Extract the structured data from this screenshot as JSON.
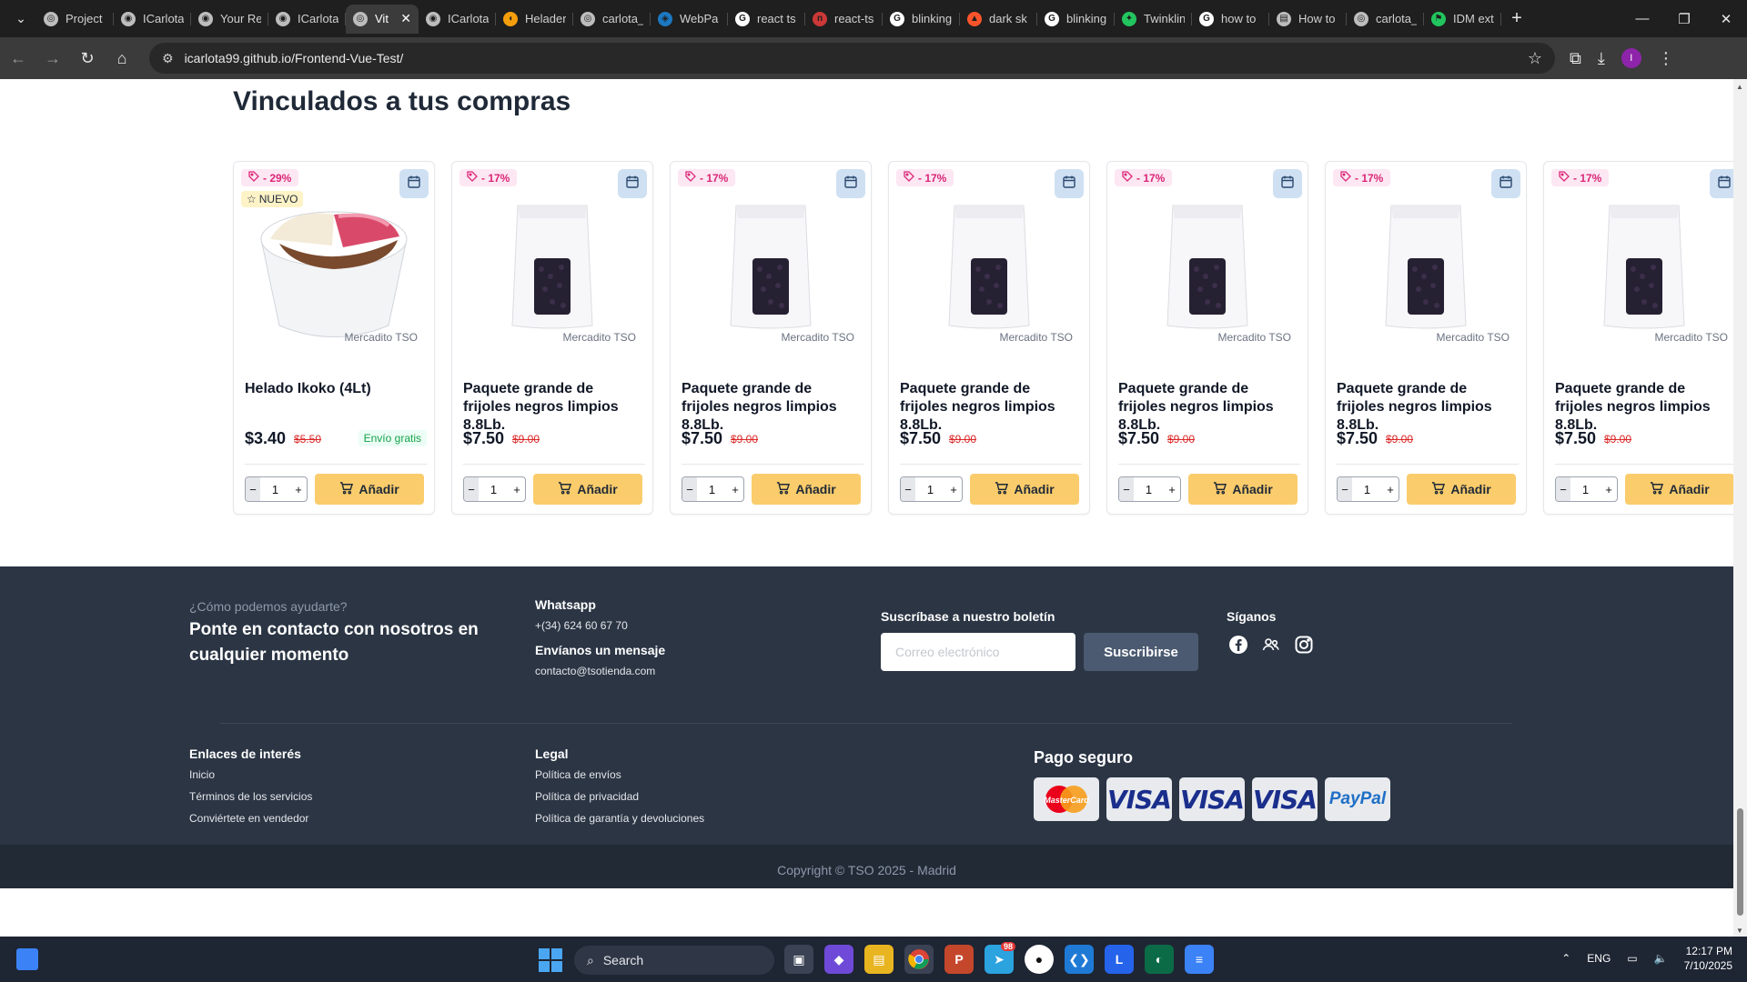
{
  "browser": {
    "tabs": [
      {
        "title": "Project",
        "icon": "globe-icon",
        "active": false
      },
      {
        "title": "ICarlota",
        "icon": "github-icon",
        "active": false
      },
      {
        "title": "Your Re",
        "icon": "github-icon",
        "active": false
      },
      {
        "title": "ICarlota",
        "icon": "github-icon",
        "active": false
      },
      {
        "title": "Vit",
        "icon": "globe-icon",
        "active": true
      },
      {
        "title": "ICarlota",
        "icon": "github-icon",
        "active": false
      },
      {
        "title": "Helader",
        "icon": "cone-icon",
        "active": false
      },
      {
        "title": "carlota_",
        "icon": "globe-icon",
        "active": false
      },
      {
        "title": "WebPa",
        "icon": "webpack-icon",
        "active": false
      },
      {
        "title": "react ts",
        "icon": "google-icon",
        "active": false
      },
      {
        "title": "react-ts",
        "icon": "npm-icon",
        "active": false
      },
      {
        "title": "blinking",
        "icon": "google-icon",
        "active": false
      },
      {
        "title": "dark sk",
        "icon": "brave-icon",
        "active": false
      },
      {
        "title": "blinking",
        "icon": "google-icon",
        "active": false
      },
      {
        "title": "Twinklin",
        "icon": "twinkle-icon",
        "active": false
      },
      {
        "title": "how to",
        "icon": "google-icon",
        "active": false
      },
      {
        "title": "How to",
        "icon": "doc-icon",
        "active": false
      },
      {
        "title": "carlota_",
        "icon": "globe-icon",
        "active": false
      },
      {
        "title": "IDM ext",
        "icon": "flag-icon",
        "active": false
      }
    ],
    "url": "icarlota99.github.io/Frontend-Vue-Test/",
    "profile_initial": "I"
  },
  "section": {
    "title": "Vinculados a tus compras"
  },
  "products": [
    {
      "discount": "- 29%",
      "is_new": true,
      "new_label": "NUEVO",
      "image": "ice-cream-tub",
      "seller": "Mercadito TSO",
      "name": "Helado Ikoko (4Lt)",
      "price": "$3.40",
      "old_price": "$5.50",
      "shipping": "Envío gratis",
      "qty": "1",
      "add_label": "Añadir"
    },
    {
      "discount": "- 17%",
      "is_new": false,
      "new_label": "",
      "image": "bean-bag",
      "seller": "Mercadito TSO",
      "name": "Paquete grande de frijoles negros limpios 8.8Lb.",
      "price": "$7.50",
      "old_price": "$9.00",
      "shipping": "",
      "qty": "1",
      "add_label": "Añadir"
    },
    {
      "discount": "- 17%",
      "is_new": false,
      "new_label": "",
      "image": "bean-bag",
      "seller": "Mercadito TSO",
      "name": "Paquete grande de frijoles negros limpios 8.8Lb.",
      "price": "$7.50",
      "old_price": "$9.00",
      "shipping": "",
      "qty": "1",
      "add_label": "Añadir"
    },
    {
      "discount": "- 17%",
      "is_new": false,
      "new_label": "",
      "image": "bean-bag",
      "seller": "Mercadito TSO",
      "name": "Paquete grande de frijoles negros limpios 8.8Lb.",
      "price": "$7.50",
      "old_price": "$9.00",
      "shipping": "",
      "qty": "1",
      "add_label": "Añadir"
    },
    {
      "discount": "- 17%",
      "is_new": false,
      "new_label": "",
      "image": "bean-bag",
      "seller": "Mercadito TSO",
      "name": "Paquete grande de frijoles negros limpios 8.8Lb.",
      "price": "$7.50",
      "old_price": "$9.00",
      "shipping": "",
      "qty": "1",
      "add_label": "Añadir"
    },
    {
      "discount": "- 17%",
      "is_new": false,
      "new_label": "",
      "image": "bean-bag",
      "seller": "Mercadito TSO",
      "name": "Paquete grande de frijoles negros limpios 8.8Lb.",
      "price": "$7.50",
      "old_price": "$9.00",
      "shipping": "",
      "qty": "1",
      "add_label": "Añadir"
    },
    {
      "discount": "- 17%",
      "is_new": false,
      "new_label": "",
      "image": "bean-bag",
      "seller": "Mercadito TSO",
      "name": "Paquete grande de frijoles negros limpios 8.8Lb.",
      "price": "$7.50",
      "old_price": "$9.00",
      "shipping": "",
      "qty": "1",
      "add_label": "Añadir"
    }
  ],
  "footer": {
    "help_question": "¿Cómo podemos ayudarte?",
    "help_text": "Ponte en contacto con nosotros en cualquier momento",
    "whatsapp_title": "Whatsapp",
    "whatsapp_number": "+(34) 624 60 67 70",
    "message_title": "Envíanos un mensaje",
    "message_email": "contacto@tsotienda.com",
    "newsletter_title": "Suscríbase a nuestro boletín",
    "email_placeholder": "Correo electrónico",
    "subscribe_label": "Suscribirse",
    "social_title": "Síganos",
    "social_icons": [
      "facebook-icon",
      "community-icon",
      "instagram-icon"
    ],
    "links_title": "Enlaces de interés",
    "links": [
      "Inicio",
      "Términos de los servicios",
      "Conviértete en vendedor"
    ],
    "legal_title": "Legal",
    "legal_links": [
      "Política de envíos",
      "Política de privacidad",
      "Política de garantía y devoluciones"
    ],
    "payment_title": "Pago seguro",
    "payment_methods": [
      "MasterCard",
      "VISA",
      "VISA",
      "VISA",
      "PayPal"
    ],
    "copyright": "Copyright © TSO 2025 - Madrid"
  },
  "taskbar": {
    "search_label": "Search",
    "language": "ENG",
    "time": "12:17 PM",
    "date": "7/10/2025",
    "telegram_badge": "98"
  },
  "colors": {
    "footer_bg": "#2b3544",
    "add_button": "#facc6b",
    "discount_text": "#db2777",
    "old_price": "#dc2626",
    "free_shipping": "#16a34a"
  }
}
